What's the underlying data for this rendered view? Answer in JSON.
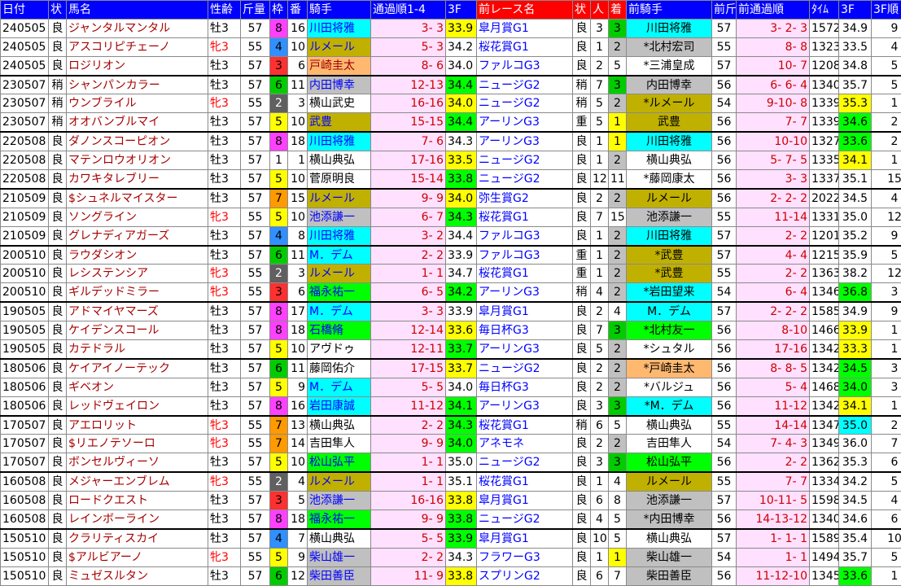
{
  "headers": [
    "日付",
    "状",
    "馬名",
    "性齢",
    "斤量",
    "枠",
    "番",
    "騎手",
    "通過順1-4",
    "3F",
    "前レース名",
    "状",
    "人",
    "着",
    "前騎手",
    "前斤",
    "前通過順",
    "ﾀｲﾑ",
    "3F",
    "3F順"
  ],
  "rows": [
    {
      "date": "240505",
      "cond": "良",
      "name": "ジャンタルマンタル",
      "sex": "牡3",
      "wt": "57",
      "waku": "8",
      "ban": "16",
      "jockey": "川田将雅",
      "jc": "cyan",
      "pass": "3- 3",
      "f3": "33.9",
      "f3c": "yellow",
      "race": "皐月賞G1",
      "rc": "良",
      "pop": "3",
      "pos": "3",
      "pj": "川田将雅",
      "pjc": "cyan",
      "pw": "57",
      "ppass": "3- 2- 3",
      "time": "1572",
      "pf3": "34.9",
      "pf3c": "",
      "rank": "9",
      "fem": false
    },
    {
      "date": "240505",
      "cond": "良",
      "name": "アスコリピチェーノ",
      "sex": "牝3",
      "wt": "55",
      "waku": "4",
      "ban": "10",
      "jockey": "ルメール",
      "jc": "olive",
      "pass": "5- 3",
      "f3": "34.2",
      "f3c": "",
      "race": "桜花賞G1",
      "rc": "良",
      "pop": "1",
      "pos": "2",
      "pj": "*北村宏司",
      "pjc": "gray",
      "pw": "55",
      "ppass": "8- 8",
      "time": "1323",
      "pf3": "33.5",
      "pf3c": "",
      "rank": "4",
      "fem": true
    },
    {
      "date": "240505",
      "cond": "良",
      "name": "ロジリオン",
      "sex": "牡3",
      "wt": "57",
      "waku": "3",
      "ban": "6",
      "jockey": "戸崎圭太",
      "jc": "orange",
      "pass": "8- 6",
      "f3": "34.0",
      "f3c": "",
      "race": "ファルコG3",
      "rc": "良",
      "pop": "2",
      "pos": "5",
      "pj": "*三浦皇成",
      "pjc": "",
      "pw": "57",
      "ppass": "10- 7",
      "time": "1208",
      "pf3": "34.8",
      "pf3c": "",
      "rank": "5",
      "fem": false
    },
    {
      "date": "230507",
      "cond": "稍",
      "name": "シャンパンカラー",
      "sex": "牡3",
      "wt": "57",
      "waku": "6",
      "ban": "11",
      "jockey": "内田博幸",
      "jc": "gray",
      "pass": "12-13",
      "f3": "34.4",
      "f3c": "green",
      "race": "ニュージG2",
      "rc": "稍",
      "pop": "7",
      "pos": "3",
      "pj": "内田博幸",
      "pjc": "gray",
      "pw": "56",
      "ppass": "6- 6- 4",
      "time": "1340",
      "pf3": "35.7",
      "pf3c": "",
      "rank": "5",
      "fem": false,
      "sep": true
    },
    {
      "date": "230507",
      "cond": "稍",
      "name": "ウンブライル",
      "sex": "牝3",
      "wt": "55",
      "waku": "2",
      "ban": "3",
      "jockey": "横山武史",
      "jc": "",
      "pass": "16-16",
      "f3": "34.0",
      "f3c": "yellow",
      "race": "ニュージG2",
      "rc": "稍",
      "pop": "5",
      "pos": "2",
      "pj": "*ルメール",
      "pjc": "olive",
      "pw": "54",
      "ppass": "9-10- 8",
      "time": "1339",
      "pf3": "35.3",
      "pf3c": "yellow",
      "rank": "1",
      "fem": true
    },
    {
      "date": "230507",
      "cond": "稍",
      "name": "オオバンブルマイ",
      "sex": "牡3",
      "wt": "57",
      "waku": "5",
      "ban": "10",
      "jockey": "武豊",
      "jc": "olive",
      "pass": "15-15",
      "f3": "34.4",
      "f3c": "green",
      "race": "アーリンG3",
      "rc": "重",
      "pop": "5",
      "pos": "1",
      "pj": "武豊",
      "pjc": "olive",
      "pw": "56",
      "ppass": "7- 7",
      "time": "1339",
      "pf3": "34.6",
      "pf3c": "green",
      "rank": "2",
      "fem": false
    },
    {
      "date": "220508",
      "cond": "良",
      "name": "ダノンスコーピオン",
      "sex": "牡3",
      "wt": "57",
      "waku": "8",
      "ban": "18",
      "jockey": "川田将雅",
      "jc": "cyan",
      "pass": "7- 6",
      "f3": "34.3",
      "f3c": "",
      "race": "アーリンG3",
      "rc": "良",
      "pop": "1",
      "pos": "1",
      "pj": "川田将雅",
      "pjc": "cyan",
      "pw": "56",
      "ppass": "10-10",
      "time": "1327",
      "pf3": "33.6",
      "pf3c": "green",
      "rank": "2",
      "fem": false,
      "sep": true
    },
    {
      "date": "220508",
      "cond": "良",
      "name": "マテンロウオリオン",
      "sex": "牡3",
      "wt": "57",
      "waku": "1",
      "ban": "1",
      "jockey": "横山典弘",
      "jc": "",
      "pass": "17-16",
      "f3": "33.5",
      "f3c": "yellow",
      "race": "ニュージG2",
      "rc": "良",
      "pop": "1",
      "pos": "2",
      "pj": "横山典弘",
      "pjc": "",
      "pw": "56",
      "ppass": "5- 7- 5",
      "time": "1335",
      "pf3": "34.1",
      "pf3c": "yellow",
      "rank": "1",
      "fem": false
    },
    {
      "date": "220508",
      "cond": "良",
      "name": "カワキタレブリー",
      "sex": "牡3",
      "wt": "57",
      "waku": "5",
      "ban": "10",
      "jockey": "菅原明良",
      "jc": "",
      "pass": "15-14",
      "f3": "33.8",
      "f3c": "green",
      "race": "ニュージG2",
      "rc": "良",
      "pop": "12",
      "pos": "11",
      "pj": "*藤岡康太",
      "pjc": "",
      "pw": "56",
      "ppass": "3- 3",
      "time": "1337",
      "pf3": "35.1",
      "pf3c": "",
      "rank": "15",
      "fem": false
    },
    {
      "date": "210509",
      "cond": "良",
      "name": "$シュネルマイスター",
      "sex": "牡3",
      "wt": "57",
      "waku": "7",
      "ban": "15",
      "jockey": "ルメール",
      "jc": "olive",
      "pass": "9- 9",
      "f3": "34.0",
      "f3c": "yellow",
      "race": "弥生賞G2",
      "rc": "良",
      "pop": "2",
      "pos": "2",
      "pj": "ルメール",
      "pjc": "olive",
      "pw": "56",
      "ppass": "2- 2- 2",
      "time": "2022",
      "pf3": "34.5",
      "pf3c": "",
      "rank": "4",
      "fem": false,
      "sep": true
    },
    {
      "date": "210509",
      "cond": "良",
      "name": "ソングライン",
      "sex": "牝3",
      "wt": "55",
      "waku": "5",
      "ban": "10",
      "jockey": "池添謙一",
      "jc": "gray",
      "pass": "6- 7",
      "f3": "34.3",
      "f3c": "green",
      "race": "桜花賞G1",
      "rc": "良",
      "pop": "7",
      "pos": "15",
      "pj": "池添謙一",
      "pjc": "gray",
      "pw": "55",
      "ppass": "11-14",
      "time": "1331",
      "pf3": "35.0",
      "pf3c": "",
      "rank": "12",
      "fem": true
    },
    {
      "date": "210509",
      "cond": "良",
      "name": "グレナディアガーズ",
      "sex": "牡3",
      "wt": "57",
      "waku": "4",
      "ban": "8",
      "jockey": "川田将雅",
      "jc": "cyan",
      "pass": "3- 2",
      "f3": "34.4",
      "f3c": "",
      "race": "ファルコG3",
      "rc": "良",
      "pop": "1",
      "pos": "2",
      "pj": "川田将雅",
      "pjc": "cyan",
      "pw": "57",
      "ppass": "2- 2",
      "time": "1201",
      "pf3": "35.2",
      "pf3c": "",
      "rank": "9",
      "fem": false
    },
    {
      "date": "200510",
      "cond": "良",
      "name": "ラウダシオン",
      "sex": "牡3",
      "wt": "57",
      "waku": "6",
      "ban": "11",
      "jockey": "M．デム",
      "jc": "cyan",
      "pass": "2- 2",
      "f3": "33.9",
      "f3c": "",
      "race": "ファルコG3",
      "rc": "重",
      "pop": "1",
      "pos": "2",
      "pj": "*武豊",
      "pjc": "olive",
      "pw": "57",
      "ppass": "4- 4",
      "time": "1215",
      "pf3": "35.9",
      "pf3c": "",
      "rank": "5",
      "fem": false,
      "sep": true
    },
    {
      "date": "200510",
      "cond": "良",
      "name": "レシステンシア",
      "sex": "牝3",
      "wt": "55",
      "waku": "2",
      "ban": "3",
      "jockey": "ルメール",
      "jc": "olive",
      "pass": "1- 1",
      "f3": "34.7",
      "f3c": "",
      "race": "桜花賞G1",
      "rc": "重",
      "pop": "1",
      "pos": "2",
      "pj": "*武豊",
      "pjc": "olive",
      "pw": "55",
      "ppass": "2- 2",
      "time": "1363",
      "pf3": "38.2",
      "pf3c": "",
      "rank": "12",
      "fem": true
    },
    {
      "date": "200510",
      "cond": "良",
      "name": "ギルデッドミラー",
      "sex": "牝3",
      "wt": "55",
      "waku": "3",
      "ban": "6",
      "jockey": "福永祐一",
      "jc": "green",
      "pass": "6- 5",
      "f3": "34.2",
      "f3c": "green",
      "race": "アーリンG3",
      "rc": "稍",
      "pop": "4",
      "pos": "2",
      "pj": "*岩田望来",
      "pjc": "cyan",
      "pw": "54",
      "ppass": "6- 4",
      "time": "1346",
      "pf3": "36.8",
      "pf3c": "green",
      "rank": "3",
      "fem": true
    },
    {
      "date": "190505",
      "cond": "良",
      "name": "アドマイヤマーズ",
      "sex": "牡3",
      "wt": "57",
      "waku": "8",
      "ban": "17",
      "jockey": "M．デム",
      "jc": "cyan",
      "pass": "3- 3",
      "f3": "33.9",
      "f3c": "",
      "race": "皐月賞G1",
      "rc": "良",
      "pop": "2",
      "pos": "4",
      "pj": "M．デム",
      "pjc": "cyan",
      "pw": "57",
      "ppass": "2- 2- 2",
      "time": "1585",
      "pf3": "34.9",
      "pf3c": "",
      "rank": "9",
      "fem": false,
      "sep": true
    },
    {
      "date": "190505",
      "cond": "良",
      "name": "ケイデンスコール",
      "sex": "牡3",
      "wt": "57",
      "waku": "8",
      "ban": "18",
      "jockey": "石橋脩",
      "jc": "green",
      "pass": "12-14",
      "f3": "33.6",
      "f3c": "yellow",
      "race": "毎日杯G3",
      "rc": "良",
      "pop": "7",
      "pos": "3",
      "pj": "*北村友一",
      "pjc": "green",
      "pw": "56",
      "ppass": "8-10",
      "time": "1466",
      "pf3": "33.9",
      "pf3c": "yellow",
      "rank": "1",
      "fem": false
    },
    {
      "date": "190505",
      "cond": "良",
      "name": "カテドラル",
      "sex": "牡3",
      "wt": "57",
      "waku": "5",
      "ban": "10",
      "jockey": "アヴドゥ",
      "jc": "",
      "pass": "12-11",
      "f3": "33.7",
      "f3c": "green",
      "race": "アーリンG3",
      "rc": "良",
      "pop": "5",
      "pos": "2",
      "pj": "*シュタル",
      "pjc": "",
      "pw": "56",
      "ppass": "17-16",
      "time": "1342",
      "pf3": "33.3",
      "pf3c": "yellow",
      "rank": "1",
      "fem": false
    },
    {
      "date": "180506",
      "cond": "良",
      "name": "ケイアイノーテック",
      "sex": "牡3",
      "wt": "57",
      "waku": "6",
      "ban": "11",
      "jockey": "藤岡佑介",
      "jc": "",
      "pass": "17-15",
      "f3": "33.7",
      "f3c": "yellow",
      "race": "ニュージG2",
      "rc": "良",
      "pop": "2",
      "pos": "2",
      "pj": "*戸崎圭太",
      "pjc": "orange",
      "pw": "56",
      "ppass": "8- 8- 5",
      "time": "1342",
      "pf3": "34.5",
      "pf3c": "green",
      "rank": "3",
      "fem": false,
      "sep": true
    },
    {
      "date": "180506",
      "cond": "良",
      "name": "ギベオン",
      "sex": "牡3",
      "wt": "57",
      "waku": "5",
      "ban": "9",
      "jockey": "M．デム",
      "jc": "cyan",
      "pass": "5- 5",
      "f3": "34.0",
      "f3c": "",
      "race": "毎日杯G3",
      "rc": "良",
      "pop": "2",
      "pos": "2",
      "pj": "*バルジュ",
      "pjc": "",
      "pw": "56",
      "ppass": "5- 4",
      "time": "1468",
      "pf3": "34.0",
      "pf3c": "green",
      "rank": "3",
      "fem": false
    },
    {
      "date": "180506",
      "cond": "良",
      "name": "レッドヴェイロン",
      "sex": "牡3",
      "wt": "57",
      "waku": "8",
      "ban": "16",
      "jockey": "岩田康誠",
      "jc": "cyan",
      "pass": "11-12",
      "f3": "34.1",
      "f3c": "green",
      "race": "アーリンG3",
      "rc": "良",
      "pop": "3",
      "pos": "3",
      "pj": "*M．デム",
      "pjc": "cyan",
      "pw": "56",
      "ppass": "11-12",
      "time": "1342",
      "pf3": "34.1",
      "pf3c": "yellow",
      "rank": "1",
      "fem": false
    },
    {
      "date": "170507",
      "cond": "良",
      "name": "アエロリット",
      "sex": "牝3",
      "wt": "55",
      "waku": "7",
      "ban": "13",
      "jockey": "横山典弘",
      "jc": "",
      "pass": "2- 2",
      "f3": "34.3",
      "f3c": "green",
      "race": "桜花賞G1",
      "rc": "稍",
      "pop": "6",
      "pos": "5",
      "pj": "横山典弘",
      "pjc": "",
      "pw": "55",
      "ppass": "14-14",
      "time": "1347",
      "pf3": "35.0",
      "pf3c": "cyan",
      "rank": "2",
      "fem": true,
      "sep": true
    },
    {
      "date": "170507",
      "cond": "良",
      "name": "$リエノテソーロ",
      "sex": "牝3",
      "wt": "55",
      "waku": "7",
      "ban": "14",
      "jockey": "吉田隼人",
      "jc": "",
      "pass": "9- 9",
      "f3": "34.0",
      "f3c": "green",
      "race": "アネモネ",
      "rc": "良",
      "pop": "2",
      "pos": "2",
      "pj": "吉田隼人",
      "pjc": "",
      "pw": "54",
      "ppass": "7- 4- 3",
      "time": "1349",
      "pf3": "36.0",
      "pf3c": "",
      "rank": "7",
      "fem": true
    },
    {
      "date": "170507",
      "cond": "良",
      "name": "ボンセルヴィーソ",
      "sex": "牡3",
      "wt": "57",
      "waku": "5",
      "ban": "10",
      "jockey": "松山弘平",
      "jc": "green",
      "pass": "1- 1",
      "f3": "35.0",
      "f3c": "",
      "race": "ニュージG2",
      "rc": "良",
      "pop": "3",
      "pos": "3",
      "pj": "松山弘平",
      "pjc": "green",
      "pw": "56",
      "ppass": "2- 2",
      "time": "1362",
      "pf3": "35.3",
      "pf3c": "",
      "rank": "6",
      "fem": false
    },
    {
      "date": "160508",
      "cond": "良",
      "name": "メジャーエンブレム",
      "sex": "牝3",
      "wt": "55",
      "waku": "2",
      "ban": "4",
      "jockey": "ルメール",
      "jc": "olive",
      "pass": "1- 1",
      "f3": "35.1",
      "f3c": "",
      "race": "桜花賞G1",
      "rc": "良",
      "pop": "1",
      "pos": "4",
      "pj": "ルメール",
      "pjc": "olive",
      "pw": "55",
      "ppass": "7- 7",
      "time": "1334",
      "pf3": "34.2",
      "pf3c": "",
      "rank": "5",
      "fem": true,
      "sep": true
    },
    {
      "date": "160508",
      "cond": "良",
      "name": "ロードクエスト",
      "sex": "牡3",
      "wt": "57",
      "waku": "3",
      "ban": "5",
      "jockey": "池添謙一",
      "jc": "gray",
      "pass": "16-16",
      "f3": "33.8",
      "f3c": "yellow",
      "race": "皐月賞G1",
      "rc": "良",
      "pop": "6",
      "pos": "8",
      "pj": "池添謙一",
      "pjc": "gray",
      "pw": "57",
      "ppass": "10-11- 5",
      "time": "1598",
      "pf3": "34.5",
      "pf3c": "",
      "rank": "4",
      "fem": false
    },
    {
      "date": "160508",
      "cond": "良",
      "name": "レインボーライン",
      "sex": "牡3",
      "wt": "57",
      "waku": "8",
      "ban": "18",
      "jockey": "福永祐一",
      "jc": "green",
      "pass": "9- 9",
      "f3": "33.8",
      "f3c": "green",
      "race": "ニュージG2",
      "rc": "良",
      "pop": "4",
      "pos": "5",
      "pj": "*内田博幸",
      "pjc": "gray",
      "pw": "56",
      "ppass": "14-13-12",
      "time": "1340",
      "pf3": "34.6",
      "pf3c": "",
      "rank": "6",
      "fem": false
    },
    {
      "date": "150510",
      "cond": "良",
      "name": "クラリティスカイ",
      "sex": "牡3",
      "wt": "57",
      "waku": "4",
      "ban": "7",
      "jockey": "横山典弘",
      "jc": "",
      "pass": "5- 5",
      "f3": "33.9",
      "f3c": "green",
      "race": "皐月賞G1",
      "rc": "良",
      "pop": "10",
      "pos": "5",
      "pj": "横山典弘",
      "pjc": "",
      "pw": "57",
      "ppass": "1- 1- 1",
      "time": "1589",
      "pf3": "35.4",
      "pf3c": "",
      "rank": "10",
      "fem": false,
      "sep": true
    },
    {
      "date": "150510",
      "cond": "良",
      "name": "$アルビアーノ",
      "sex": "牝3",
      "wt": "55",
      "waku": "5",
      "ban": "9",
      "jockey": "柴山雄一",
      "jc": "gray",
      "pass": "2- 2",
      "f3": "34.3",
      "f3c": "",
      "race": "フラワーG3",
      "rc": "良",
      "pop": "1",
      "pos": "1",
      "pj": "柴山雄一",
      "pjc": "gray",
      "pw": "54",
      "ppass": "1- 1",
      "time": "1494",
      "pf3": "35.7",
      "pf3c": "",
      "rank": "5",
      "fem": true
    },
    {
      "date": "150510",
      "cond": "良",
      "name": "ミュゼスルタン",
      "sex": "牡3",
      "wt": "57",
      "waku": "6",
      "ban": "12",
      "jockey": "柴田善臣",
      "jc": "gray",
      "pass": "11- 9",
      "f3": "33.8",
      "f3c": "yellow",
      "race": "スプリンG2",
      "rc": "良",
      "pop": "6",
      "pos": "7",
      "pj": "柴田善臣",
      "pjc": "gray",
      "pw": "56",
      "ppass": "11-12-10",
      "time": "1345",
      "pf3": "33.6",
      "pf3c": "green",
      "rank": "1",
      "fem": false
    }
  ]
}
